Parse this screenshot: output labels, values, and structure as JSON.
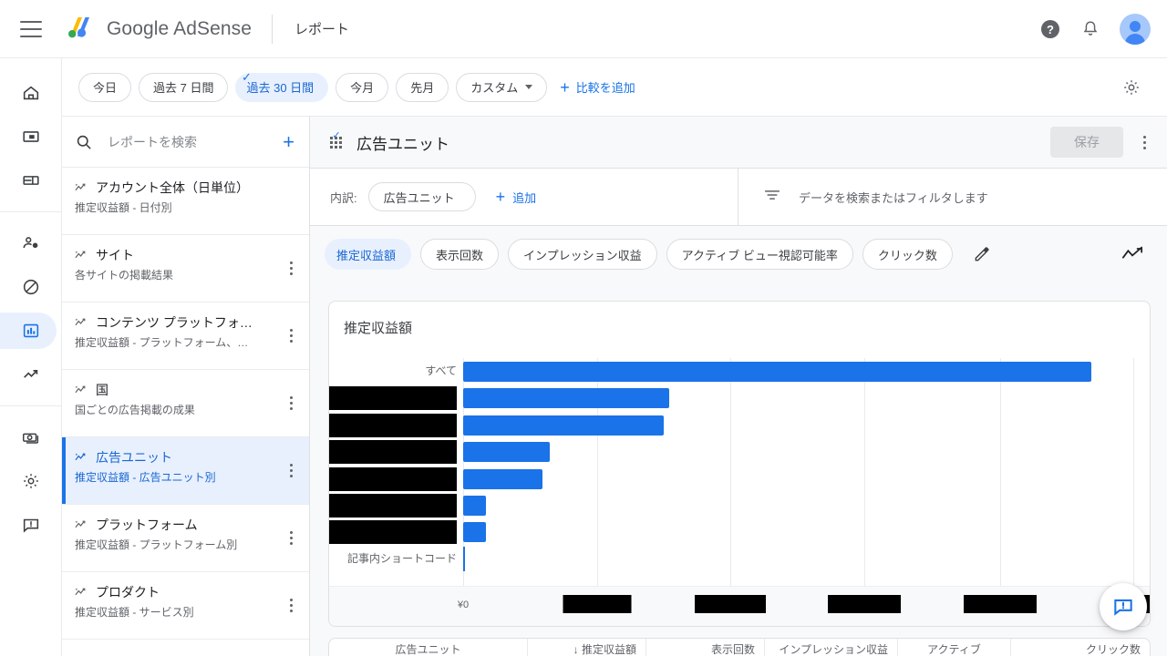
{
  "app": {
    "brand": "Google AdSense",
    "page_label": "レポート"
  },
  "topbar": {
    "menu_icon": "hamburger-icon",
    "help_icon": "help-icon",
    "notifications_icon": "bell-icon",
    "account_icon": "avatar-icon"
  },
  "date_filter": {
    "chips": [
      {
        "label": "今日",
        "selected": false,
        "has_caret": false
      },
      {
        "label": "過去 7 日間",
        "selected": false,
        "has_caret": false
      },
      {
        "label": "過去 30 日間",
        "selected": true,
        "has_caret": false
      },
      {
        "label": "今月",
        "selected": false,
        "has_caret": false
      },
      {
        "label": "先月",
        "selected": false,
        "has_caret": false
      },
      {
        "label": "カスタム",
        "selected": false,
        "has_caret": true
      }
    ],
    "add_comparison": "比較を追加",
    "settings_icon": "gear-icon"
  },
  "rail": {
    "items": [
      {
        "name": "home",
        "icon": "home-icon",
        "active": false
      },
      {
        "name": "ads",
        "icon": "ad-display-icon",
        "active": false
      },
      {
        "name": "sites",
        "icon": "sites-icon",
        "active": false
      },
      {
        "name": "privacy-messaging",
        "icon": "person-shield-icon",
        "active": false
      },
      {
        "name": "blocking-controls",
        "icon": "block-icon",
        "active": false
      },
      {
        "name": "reports",
        "icon": "bar-chart-icon",
        "active": true
      },
      {
        "name": "optimization",
        "icon": "trending-up-icon",
        "active": false
      },
      {
        "name": "payments",
        "icon": "money-icon",
        "active": false
      },
      {
        "name": "account-settings",
        "icon": "gear-icon",
        "active": false
      },
      {
        "name": "feedback",
        "icon": "message-alert-icon",
        "active": false
      }
    ]
  },
  "reports_panel": {
    "search_placeholder": "レポートを検索",
    "search_value": "",
    "search_icon": "search-icon",
    "add_icon": "plus-icon",
    "items": [
      {
        "title": "アカウント全体（日単位）",
        "subtitle": "推定収益額 - 日付別",
        "active": false,
        "has_kebab": false
      },
      {
        "title": "サイト",
        "subtitle": "各サイトの掲載結果",
        "active": false,
        "has_kebab": true
      },
      {
        "title": "コンテンツ プラットフォ…",
        "subtitle": "推定収益額 - プラットフォーム、…",
        "active": false,
        "has_kebab": true
      },
      {
        "title": "国",
        "subtitle": "国ごとの広告掲載の成果",
        "active": false,
        "has_kebab": true
      },
      {
        "title": "広告ユニット",
        "subtitle": "推定収益額 - 広告ユニット別",
        "active": true,
        "has_kebab": true
      },
      {
        "title": "プラットフォーム",
        "subtitle": "推定収益額 - プラットフォーム別",
        "active": false,
        "has_kebab": true
      },
      {
        "title": "プロダクト",
        "subtitle": "推定収益額 - サービス別",
        "active": false,
        "has_kebab": true
      }
    ]
  },
  "main": {
    "grid_icon": "apps-grid-icon",
    "title": "広告ユニット",
    "save_label": "保存",
    "more_icon": "more-vert-icon",
    "breakdown": {
      "label": "内訳:",
      "dimension": "広告ユニット",
      "add_label": "追加",
      "filter_icon": "filter-icon",
      "filter_placeholder": "データを検索またはフィルタします",
      "filter_value": ""
    },
    "metrics": [
      {
        "label": "推定収益額",
        "selected": true
      },
      {
        "label": "表示回数",
        "selected": false
      },
      {
        "label": "インプレッション収益",
        "selected": false
      },
      {
        "label": "アクティブ ビュー視認可能率",
        "selected": false
      },
      {
        "label": "クリック数",
        "selected": false
      }
    ],
    "edit_icon": "pencil-icon",
    "chart_type_icon": "line-chart-icon"
  },
  "chart_data": {
    "type": "bar",
    "orientation": "horizontal",
    "title": "推定収益額",
    "xlabel": "",
    "ylabel": "",
    "grid": true,
    "legend": "none",
    "categories": [
      "すべて",
      "[redacted]",
      "[redacted]",
      "[redacted]",
      "[redacted]",
      "[redacted]",
      "[redacted]",
      "記事内ショートコード"
    ],
    "category_redacted": [
      false,
      true,
      true,
      true,
      true,
      true,
      true,
      false
    ],
    "values": [
      100.0,
      30.8,
      30.0,
      12.9,
      12.6,
      2.7,
      2.7,
      0.15
    ],
    "value_unit": "percent-of-max",
    "xtick_labels": [
      "¥0",
      "[redacted]",
      "[redacted]",
      "[redacted]",
      "[redacted]",
      "[redacted]"
    ],
    "xtick_redacted": [
      false,
      true,
      true,
      true,
      true,
      true
    ],
    "xlim": [
      0,
      100
    ]
  },
  "table": {
    "headers": [
      "広告ユニット",
      "↓ 推定収益額",
      "表示回数",
      "インプレッション収益",
      "アクティブ",
      "クリック数"
    ]
  },
  "feedback_fab": {
    "icon": "feedback-icon"
  },
  "colors": {
    "accent": "#1a73e8",
    "accent_bg": "#e8f0fe",
    "bar": "#1a73e8",
    "surface": "#ffffff",
    "canvas": "#f8f9fa",
    "text": "#3c4043",
    "muted": "#5f6368"
  }
}
